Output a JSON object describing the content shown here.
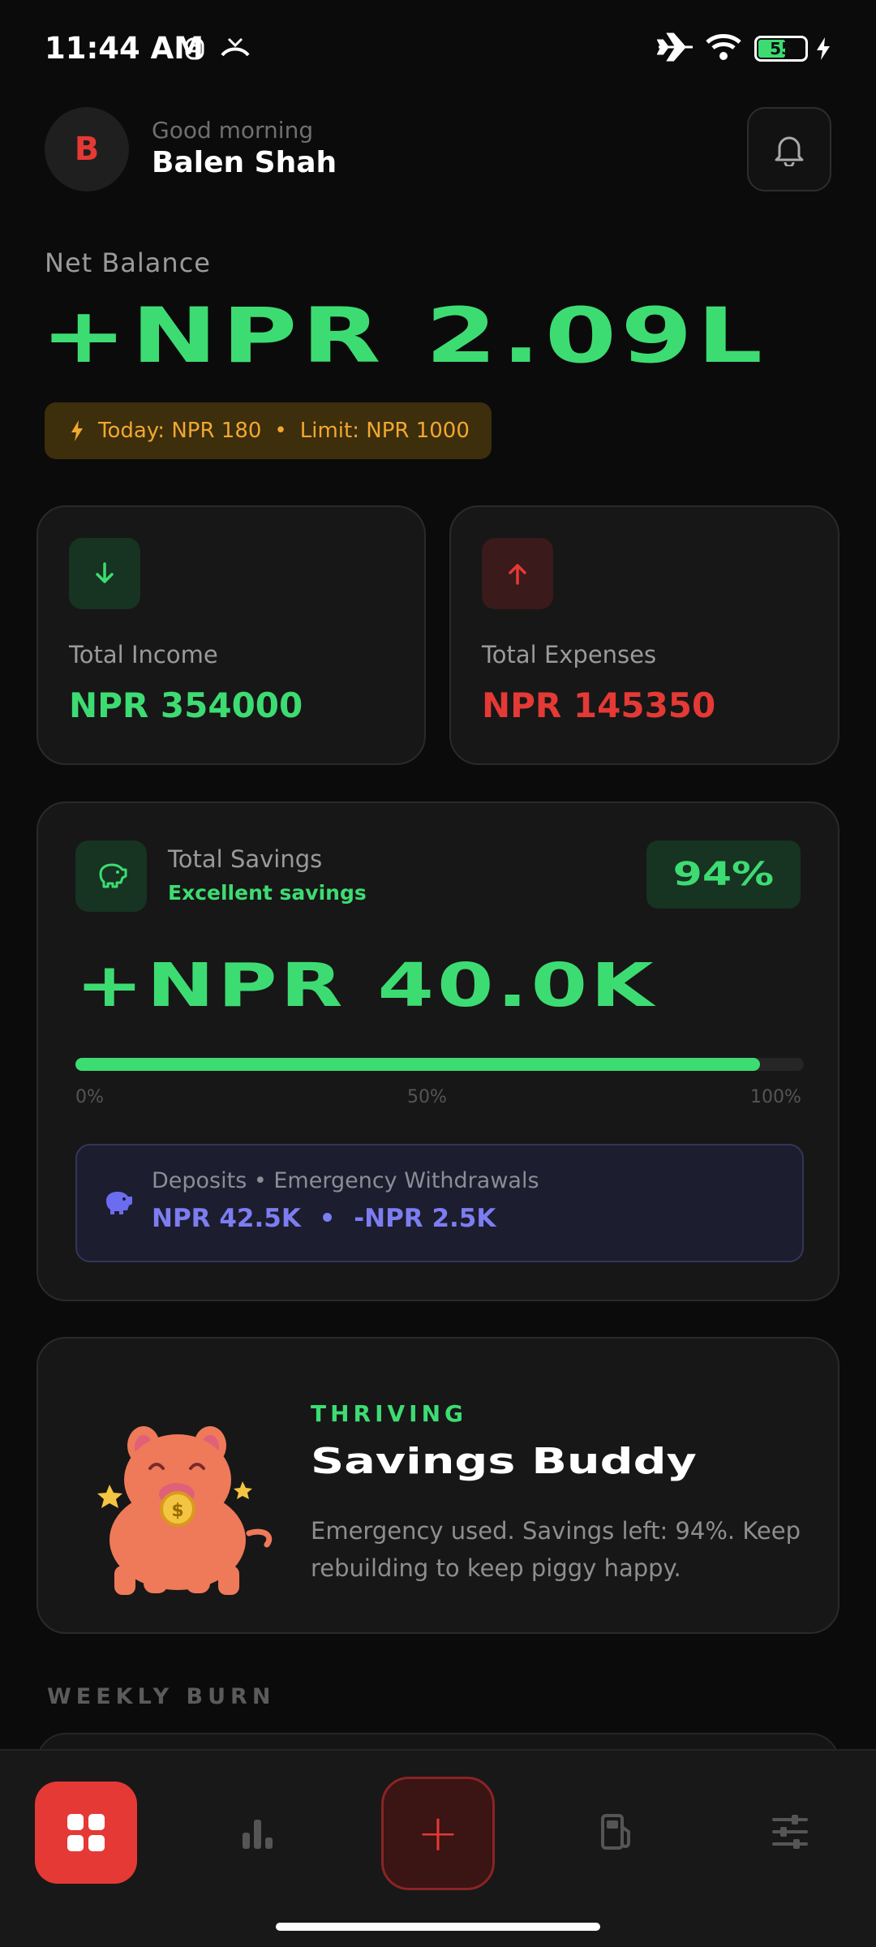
{
  "status_bar": {
    "time": "11:44 AM",
    "battery": "55"
  },
  "header": {
    "avatar_initial": "B",
    "greeting": "Good morning",
    "user_name": "Balen Shah"
  },
  "net_balance": {
    "label": "Net Balance",
    "value": "+NPR 2.09L",
    "today_text": "Today: NPR 180",
    "separator": "•",
    "limit_text": "Limit: NPR 1000"
  },
  "income": {
    "label": "Total Income",
    "value": "NPR 354000"
  },
  "expenses": {
    "label": "Total Expenses",
    "value": "NPR 145350"
  },
  "savings": {
    "title": "Total Savings",
    "subtitle": "Excellent savings",
    "percent": "94%",
    "progress": 0.94,
    "value": "+NPR 40.0K",
    "ticks": [
      "0%",
      "50%",
      "100%"
    ],
    "deposits_label": "Deposits • Emergency Withdrawals",
    "deposits_value": "NPR 42.5K",
    "withdrawals_value": "-NPR 2.5K",
    "values_separator": "•"
  },
  "buddy": {
    "state": "THRIVING",
    "title": "Savings Buddy",
    "message": "Emergency used. Savings left: 94%. Keep rebuilding to keep piggy happy.",
    "coin_symbol": "$"
  },
  "weekly_burn": {
    "title": "WEEKLY BURN"
  },
  "nav": {
    "items": [
      "dashboard-icon",
      "stats-icon",
      "plus-icon",
      "fuel-icon",
      "sliders-icon"
    ],
    "add_symbol": "+"
  },
  "colors": {
    "green": "#3ddc72",
    "red": "#e53935",
    "amber": "#f0a830",
    "indigo": "#7d7df2",
    "background": "#0b0b0b",
    "card": "#171717"
  }
}
